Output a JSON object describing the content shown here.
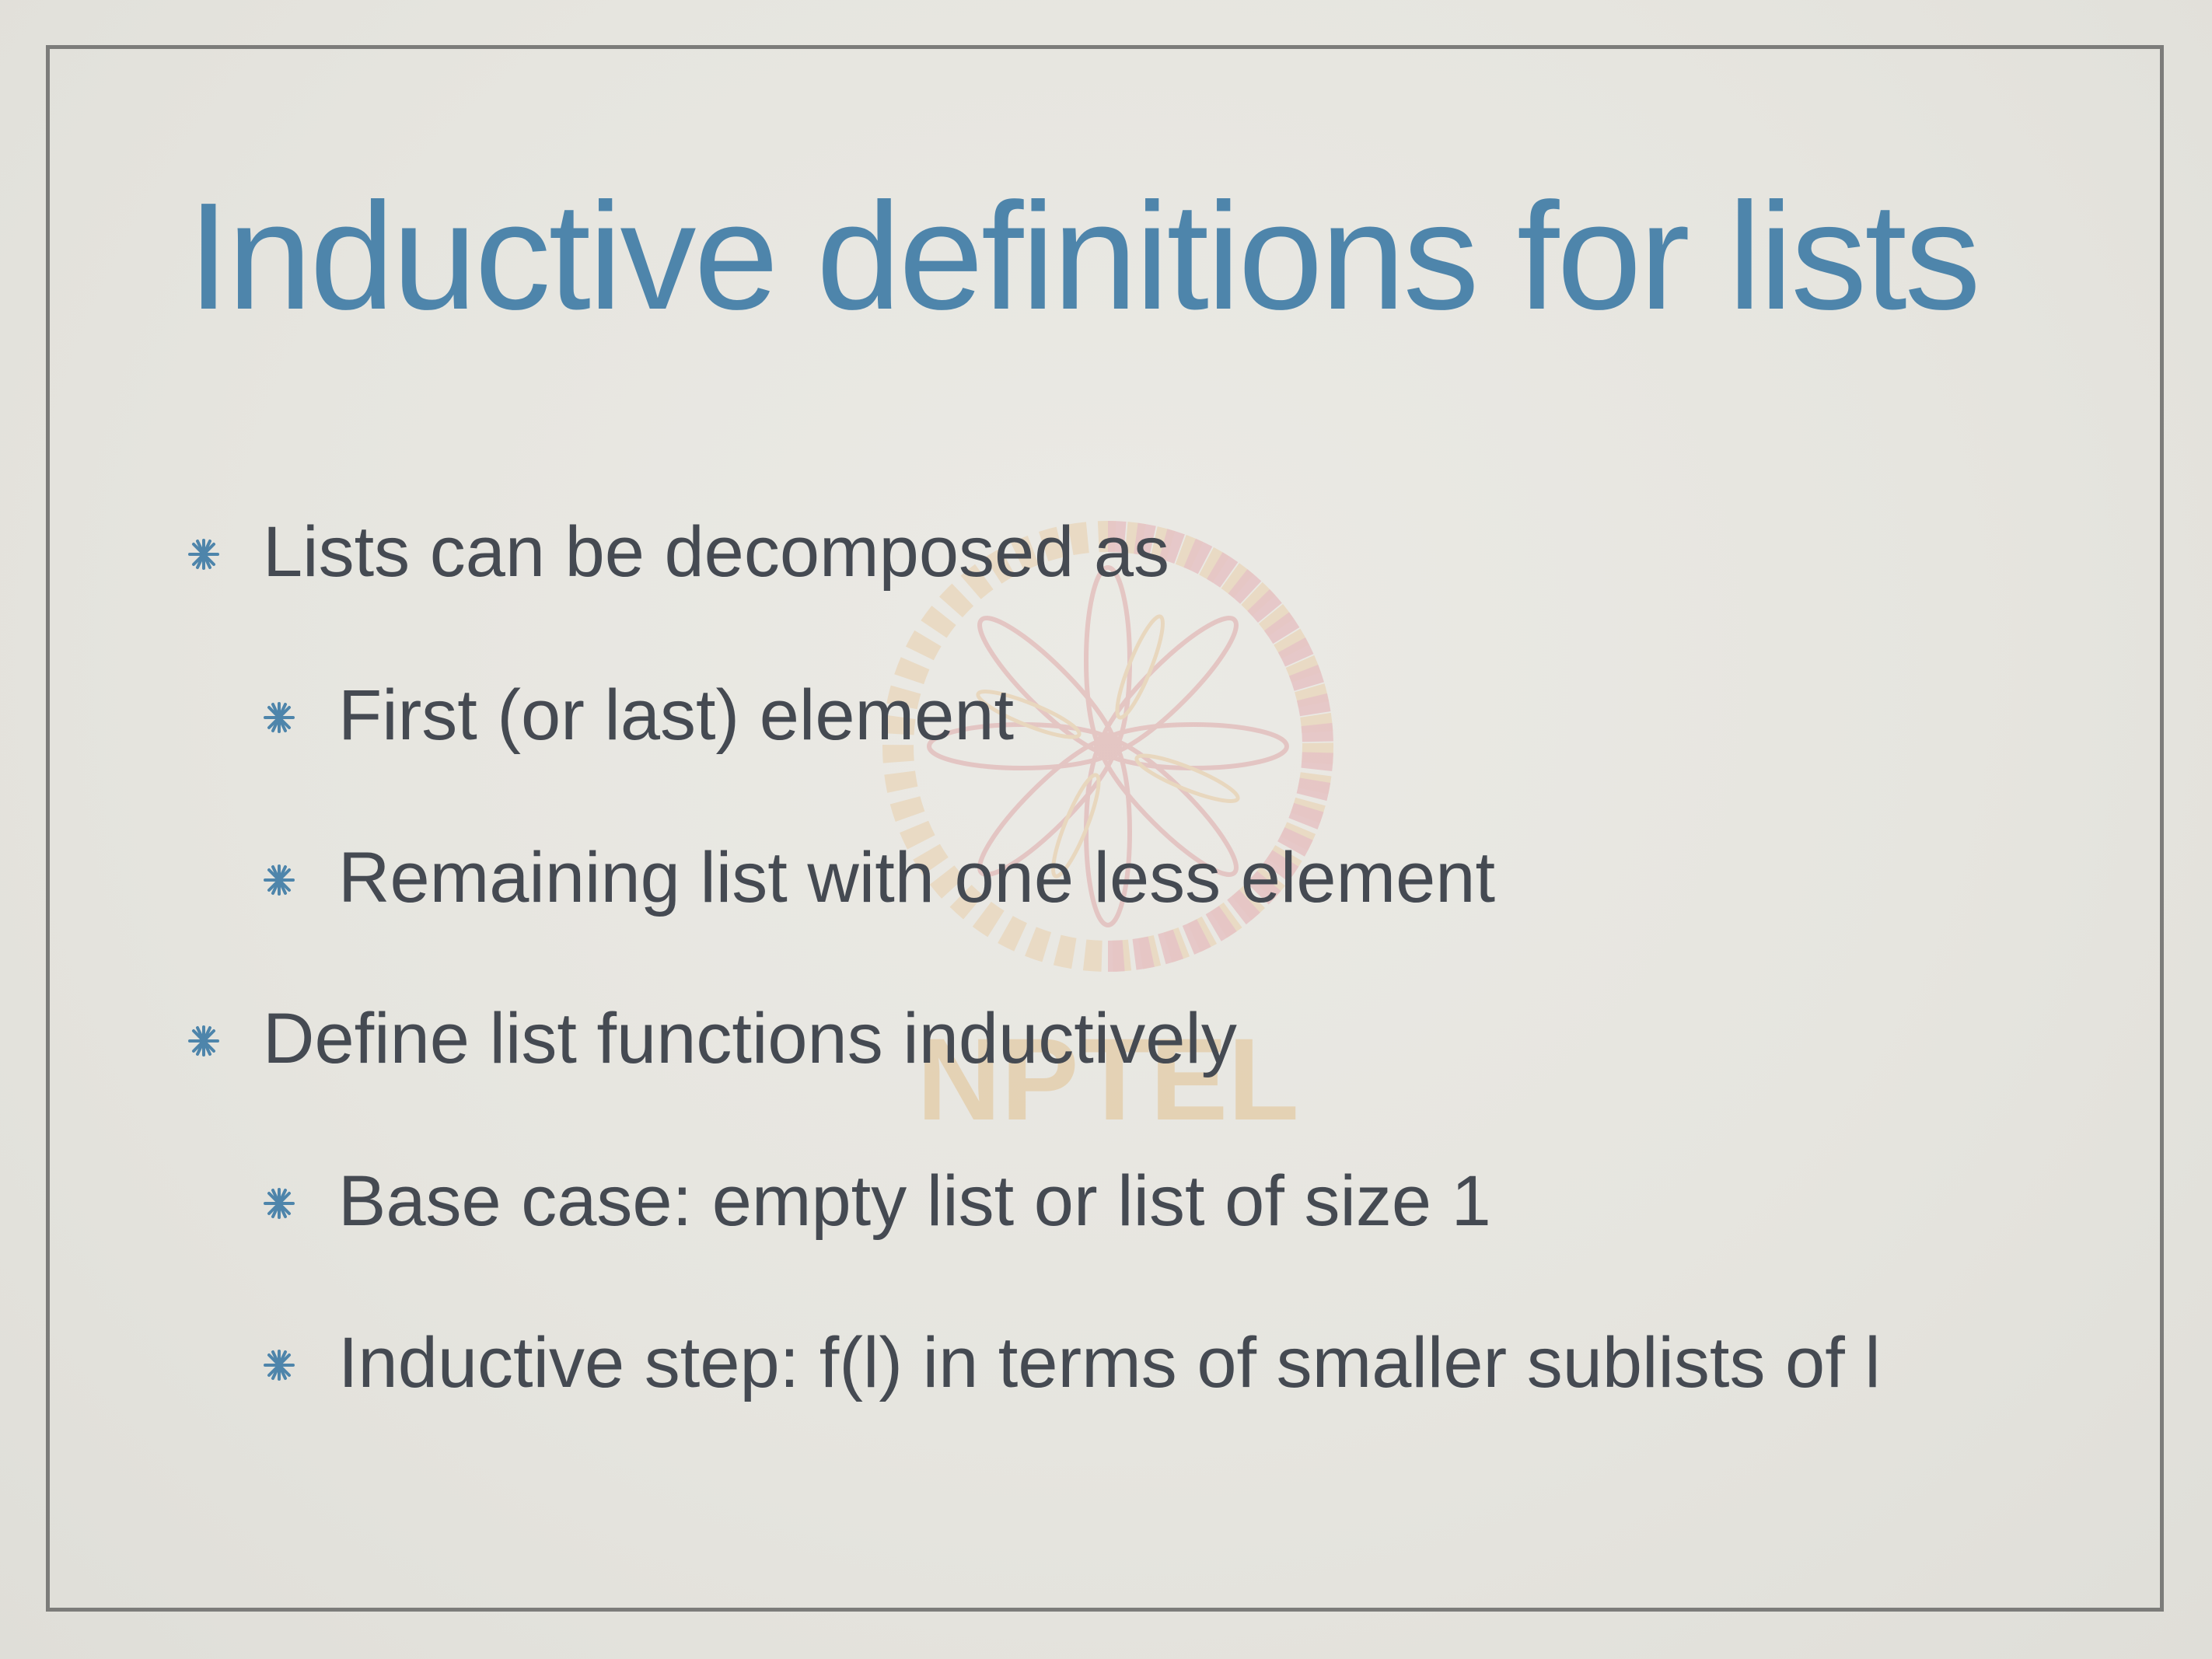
{
  "slide": {
    "title": "Inductive definitions for lists",
    "watermark": {
      "logo": "NPTEL",
      "icon": "nptel-logo-icon"
    },
    "accent_color": "#4e85ab",
    "text_color": "#454a52",
    "bullet_icon": "asterisk-bullet-icon",
    "bullets": [
      {
        "text": "Lists can be decomposed as",
        "children": [
          {
            "text": "First (or last) element"
          },
          {
            "text": "Remaining list with one less element"
          }
        ]
      },
      {
        "text": "Define list functions inductively",
        "children": [
          {
            "text": "Base case: empty list or list of size 1"
          },
          {
            "text": "Inductive step: f(l) in terms of smaller sublists of l"
          }
        ]
      }
    ]
  }
}
